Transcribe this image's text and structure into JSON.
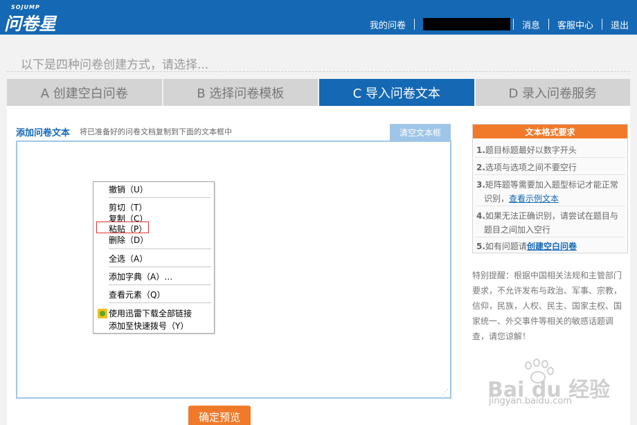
{
  "header": {
    "logo_sub": "SOJUMP",
    "logo_main": "问卷星",
    "nav": [
      "我的问卷",
      "消息",
      "客服中心",
      "退出"
    ]
  },
  "intro": "以下是四种问卷创建方式，请选择...",
  "tabs": [
    {
      "label": "A 创建空白问卷",
      "active": false
    },
    {
      "label": "B 选择问卷模板",
      "active": false
    },
    {
      "label": "C 导入问卷文本",
      "active": true
    },
    {
      "label": "D 录入问卷服务",
      "active": false
    }
  ],
  "import": {
    "title": "添加问卷文本",
    "hint": "将已准备好的问卷文档复制到下面的文本框中",
    "clear_button": "清空文本框",
    "textarea_value": "",
    "preview_button": "确定预览"
  },
  "context_menu": {
    "items": [
      "撤销（U）",
      "剪切（T）",
      "复制（C）",
      "粘贴（P）",
      "删除（D）",
      "全选（A）",
      "添加字典（A）…",
      "查看元素（Q）",
      "使用迅雷下载全部链接",
      "添加至快速拨号（Y）"
    ],
    "highlighted": "粘贴（P）"
  },
  "rules": {
    "title": "文本格式要求",
    "items": [
      {
        "num": "1.",
        "text": "题目标题最好以数字开头"
      },
      {
        "num": "2.",
        "text": "选项与选项之间不要空行"
      },
      {
        "num": "3.",
        "text": "矩阵题等需要加入题型标记才能正常",
        "text2": "识别，",
        "link": "查看示例文本"
      },
      {
        "num": "4.",
        "text": "如果无法正确识别，请尝试在题目与",
        "text2": "题目之间加入空行"
      },
      {
        "num": "5.",
        "text": "如有问题请",
        "link": "创建空白问卷"
      }
    ]
  },
  "notice": "特别提醒：根据中国相关法规和主管部门要求，不允许发布与政治、军事、宗教，信仰，民族，人权、民主、国家主权、国家统一、外交事件等相关的敏感话题调查，请您谅解！",
  "watermark": {
    "text": "Bai du 经验",
    "url": "jingyan.baidu.com"
  },
  "colors": {
    "brand_blue": "#1468b4",
    "accent_orange": "#f07a2a",
    "light_blue": "#9fc6e8"
  }
}
